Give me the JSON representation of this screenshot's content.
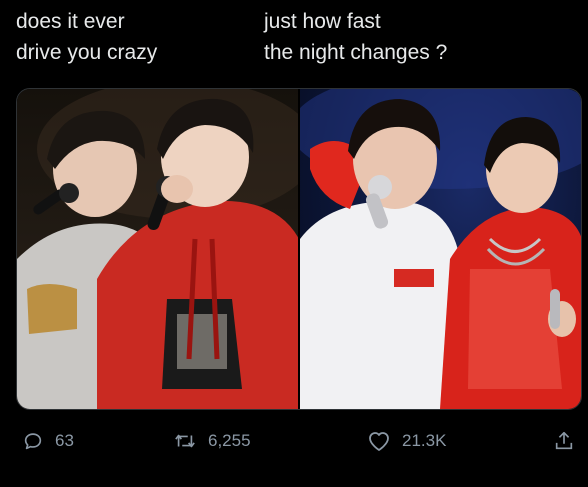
{
  "caption": {
    "left": "does it ever\ndrive you crazy",
    "right": "just how fast\nthe night changes ?"
  },
  "media": {
    "left_photo": "photo-left",
    "right_photo": "photo-right"
  },
  "actions": {
    "reply_count": "63",
    "retweet_count": "6,255",
    "like_count": "21.3K",
    "reply_icon": "reply-icon",
    "retweet_icon": "retweet-icon",
    "like_icon": "like-icon",
    "share_icon": "share-icon"
  },
  "colors": {
    "background": "#000000",
    "text": "#e7e9ea",
    "muted": "#8b98a5"
  }
}
